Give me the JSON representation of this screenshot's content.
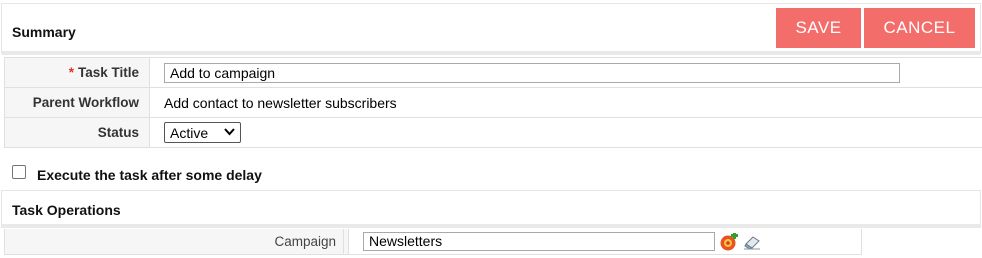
{
  "summary": {
    "title": "Summary",
    "save_label": "SAVE",
    "cancel_label": "CANCEL"
  },
  "form": {
    "task_title_label": "Task Title",
    "task_title_value": "Add to campaign",
    "required_mark": "*",
    "parent_workflow_label": "Parent Workflow",
    "parent_workflow_value": "Add contact to newsletter subscribers",
    "status_label": "Status",
    "status_value": "Active"
  },
  "delay": {
    "label": "Execute the task after some delay",
    "checked": false
  },
  "operations": {
    "title": "Task Operations",
    "campaign_label": "Campaign",
    "campaign_value": "Newsletters",
    "add_icon": "add-campaign-icon",
    "clear_icon": "eraser-icon"
  },
  "colors": {
    "button_bg": "#f36e6b",
    "label_bg": "#f6f6f6",
    "required": "#dd3333"
  }
}
